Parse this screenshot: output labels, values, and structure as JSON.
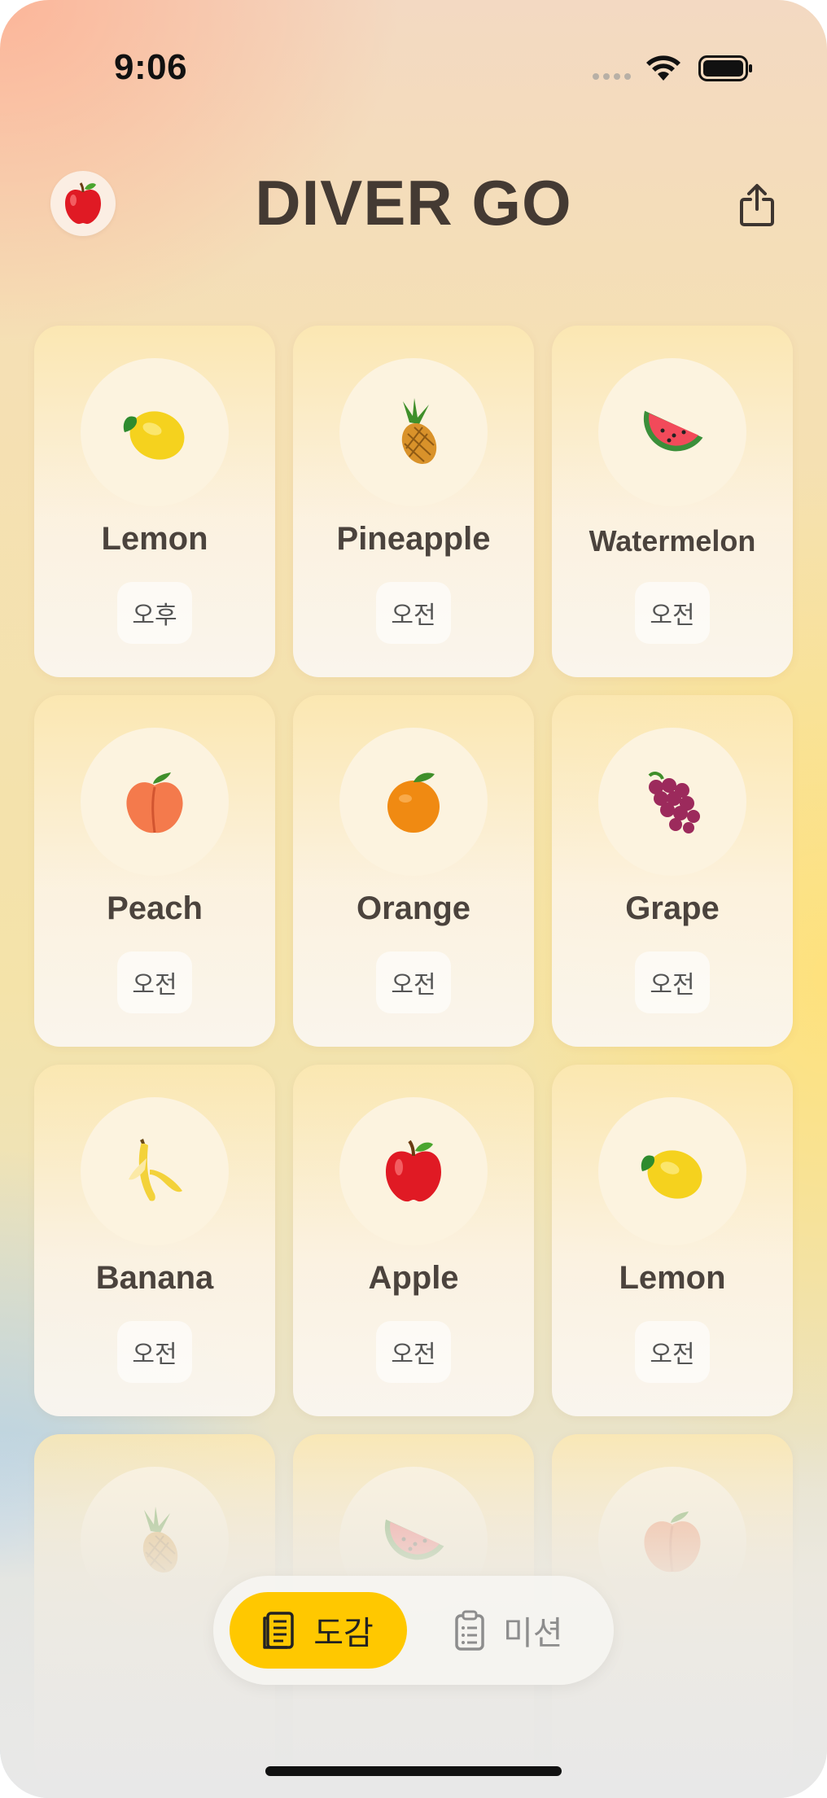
{
  "status_bar": {
    "time": "9:06"
  },
  "header": {
    "title": "DIVER GO",
    "logo_icon": "apple-icon",
    "share_icon": "share-icon"
  },
  "cards": [
    {
      "name": "Lemon",
      "period": "오후",
      "icon": "lemon"
    },
    {
      "name": "Pineapple",
      "period": "오전",
      "icon": "pineapple"
    },
    {
      "name": "Watermelon",
      "period": "오전",
      "icon": "watermelon"
    },
    {
      "name": "Peach",
      "period": "오전",
      "icon": "peach"
    },
    {
      "name": "Orange",
      "period": "오전",
      "icon": "orange"
    },
    {
      "name": "Grape",
      "period": "오전",
      "icon": "grape"
    },
    {
      "name": "Banana",
      "period": "오전",
      "icon": "banana"
    },
    {
      "name": "Apple",
      "period": "오전",
      "icon": "apple"
    },
    {
      "name": "Lemon",
      "period": "오전",
      "icon": "lemon"
    },
    {
      "name": "",
      "period": "",
      "icon": "pineapple"
    },
    {
      "name": "",
      "period": "",
      "icon": "watermelon"
    },
    {
      "name": "",
      "period": "",
      "icon": "peach"
    }
  ],
  "tabbar": {
    "tabs": [
      {
        "label": "도감",
        "icon": "book-icon",
        "active": true
      },
      {
        "label": "미션",
        "icon": "clipboard-icon",
        "active": false
      }
    ]
  },
  "colors": {
    "accent": "#ffc800",
    "title": "#443a33"
  }
}
